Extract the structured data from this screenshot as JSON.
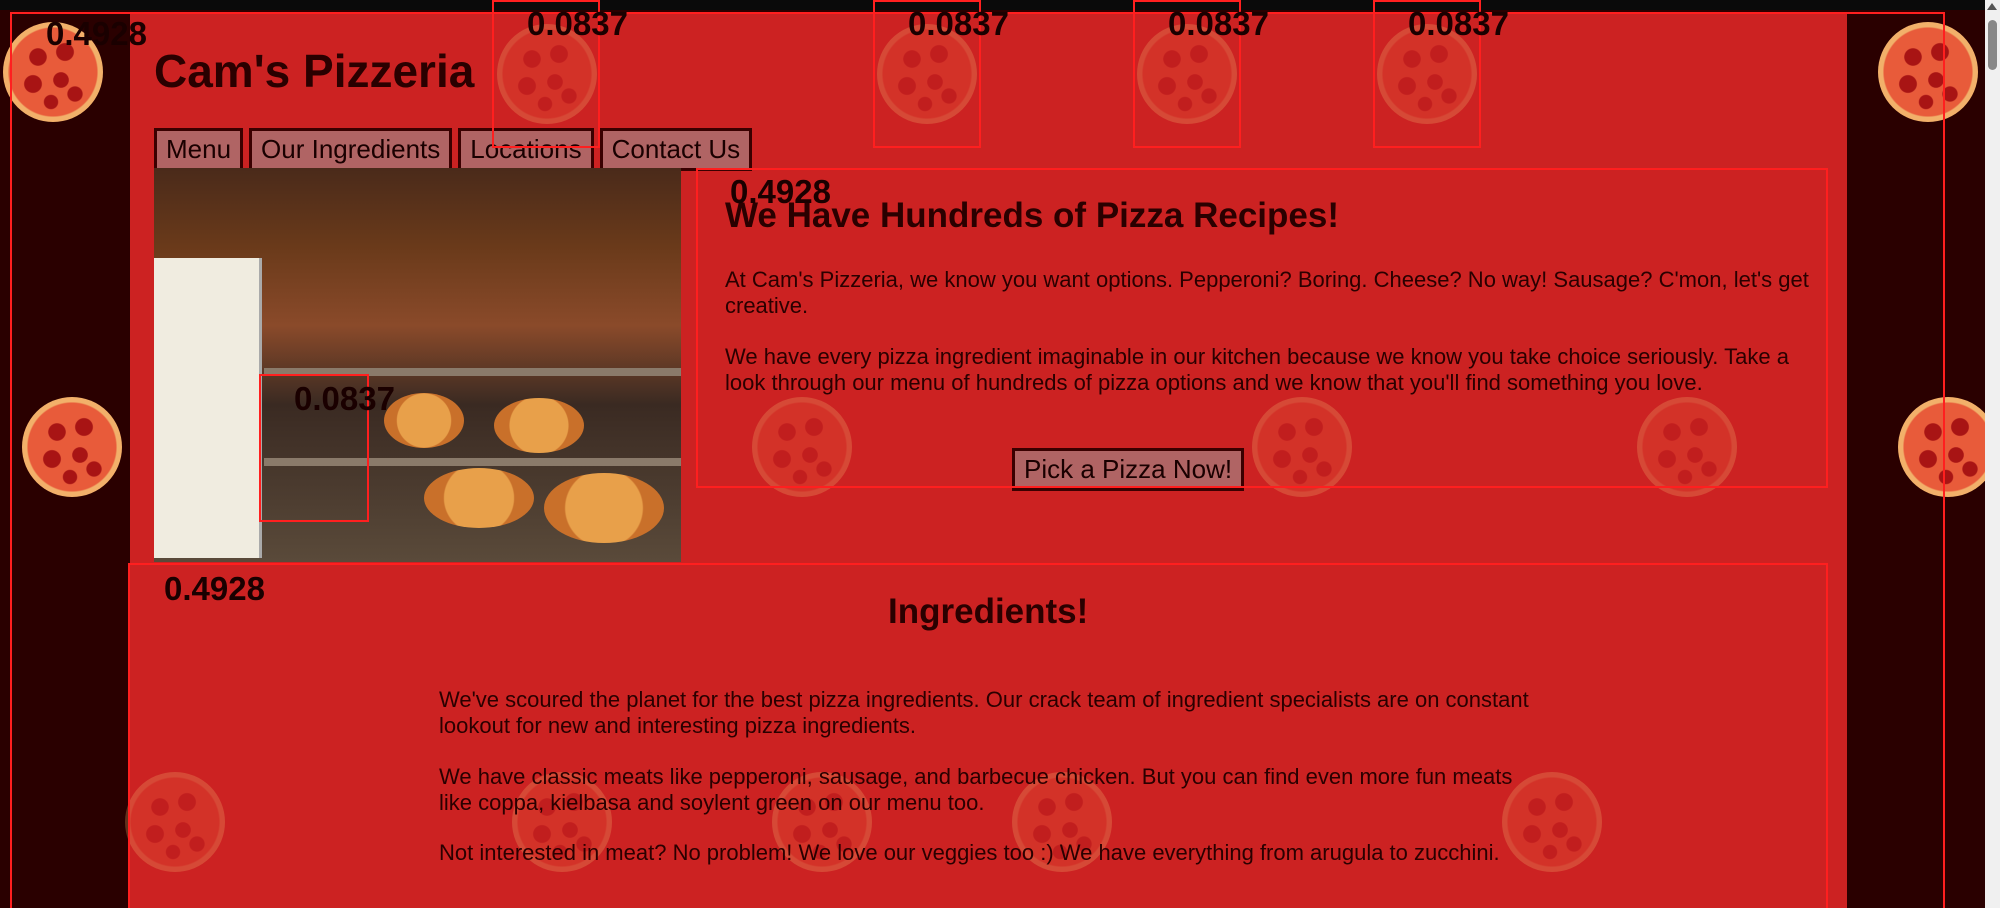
{
  "site": {
    "title": "Cam's Pizzeria"
  },
  "nav": {
    "items": [
      {
        "label": "Menu"
      },
      {
        "label": "Our Ingredients"
      },
      {
        "label": "Locations"
      },
      {
        "label": "Contact Us"
      }
    ]
  },
  "hero": {
    "heading": "We Have Hundreds of Pizza Recipes!",
    "paragraphs": [
      "At Cam's Pizzeria, we know you want options. Pepperoni? Boring. Cheese? No way! Sausage? C'mon, let's get creative.",
      "We have every pizza ingredient imaginable in our kitchen because we know you take choice seriously. Take a look through our menu of hundreds of pizza options and we know that you'll find something you love."
    ],
    "cta_label": "Pick a Pizza Now!",
    "image_icon": "pizza-shop-photo"
  },
  "ingredients": {
    "heading": "Ingredients!",
    "paragraphs": [
      "We've scoured the planet for the best pizza ingredients. Our crack team of ingredient specialists are on constant lookout for new and interesting pizza ingredients.",
      "We have classic meats like pepperoni, sausage, and barbecue chicken. But you can find even more fun meats like coppa, kielbasa and soylent green on our menu too.",
      "Not interested in meat? No problem! We love our veggies too :) We have everything from arugula to zucchini."
    ]
  },
  "overlay_scores": {
    "large": "0.4928",
    "small": "0.0837",
    "top_left_clipped": "0.4928"
  },
  "colors": {
    "content_bg": "#cc2222",
    "side_bg": "#2a0000",
    "outline": "#ff1f1f",
    "button_bg": "#b06464"
  }
}
